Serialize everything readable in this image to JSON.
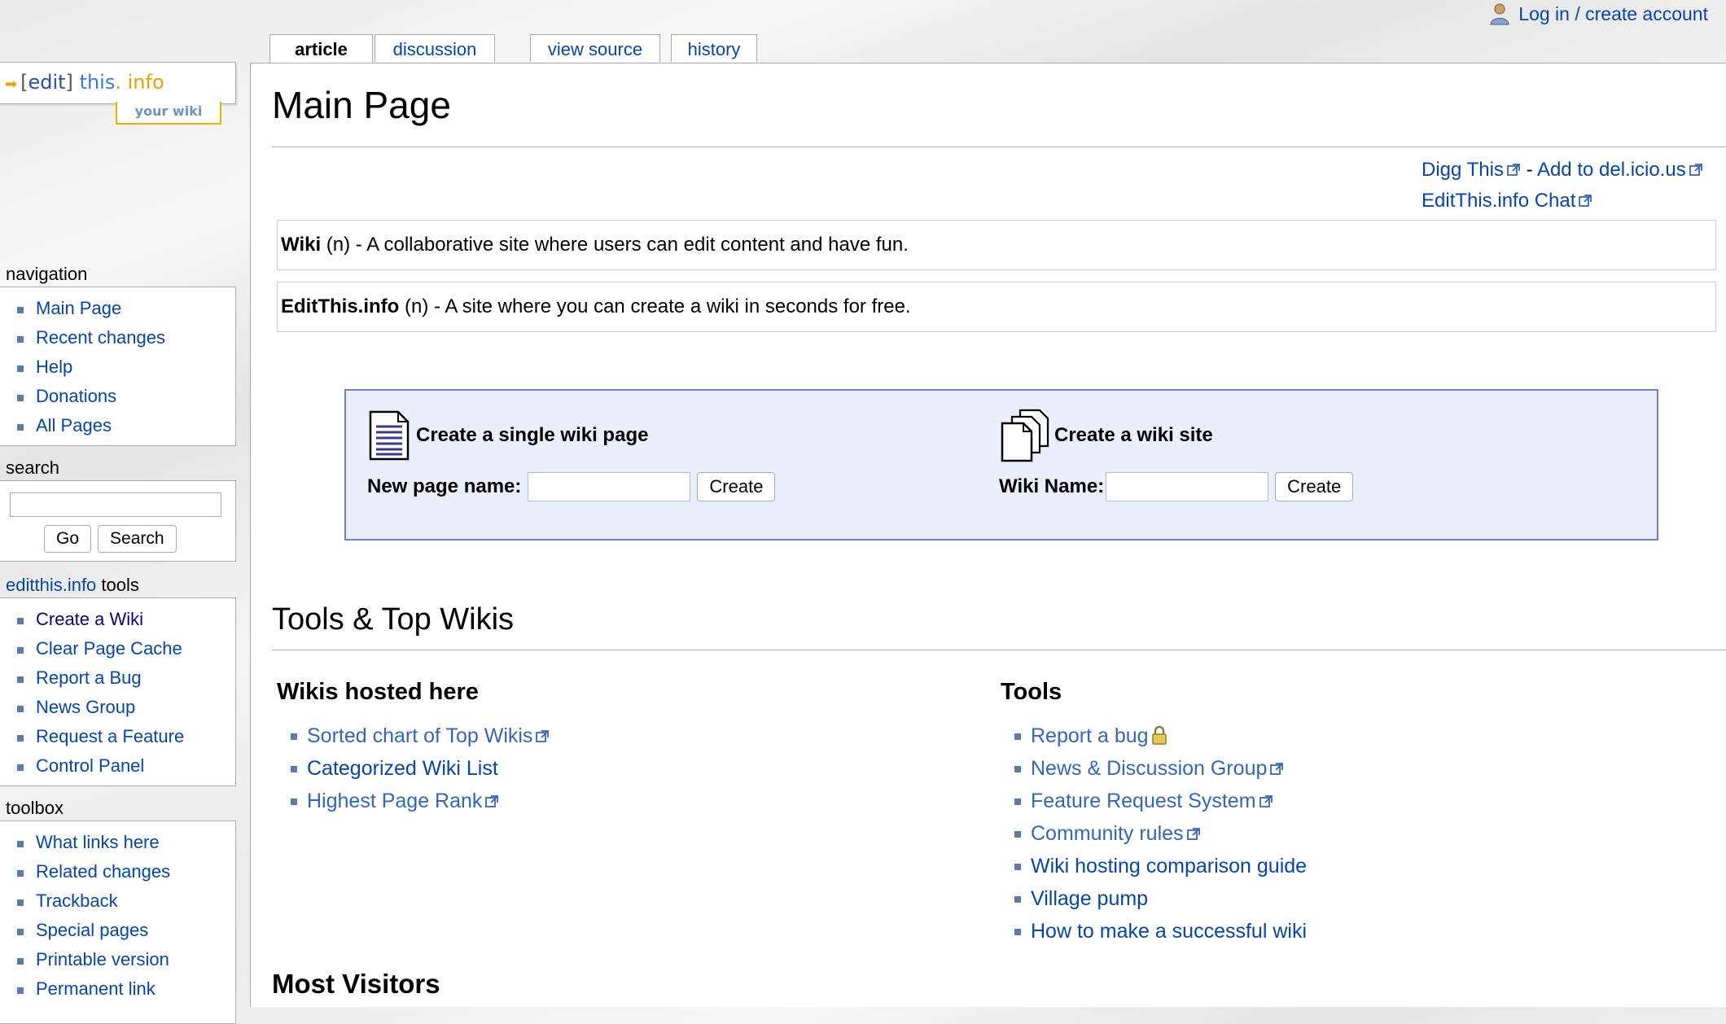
{
  "user_bar": {
    "login_label": "Log in / create account"
  },
  "tabs": [
    {
      "label": "article",
      "selected": true
    },
    {
      "label": "discussion"
    },
    {
      "label": "view source"
    },
    {
      "label": "history"
    }
  ],
  "logo": {
    "edit": "edit",
    "this": "this",
    "dot": ".",
    "info": "info",
    "tagline": "your wiki"
  },
  "sidebar": {
    "navigation": {
      "title": "navigation",
      "items": [
        "Main Page",
        "Recent changes",
        "Help",
        "Donations",
        "All Pages"
      ]
    },
    "search": {
      "title": "search",
      "input_value": "",
      "go_label": "Go",
      "search_label": "Search"
    },
    "tools": {
      "title_prefix": "editthis.info",
      "title_suffix": " tools",
      "items": [
        "Create a Wiki",
        "Clear Page Cache",
        "Report a Bug",
        "News Group",
        "Request a Feature",
        "Control Panel"
      ]
    },
    "toolbox": {
      "title": "toolbox",
      "items": [
        "What links here",
        "Related changes",
        "Trackback",
        "Special pages",
        "Printable version",
        "Permanent link"
      ]
    }
  },
  "content": {
    "heading": "Main Page",
    "top_links": {
      "digg": "Digg This",
      "sep": " - ",
      "delicious": "Add to del.icio.us",
      "chat": "EditThis.info Chat"
    },
    "definitions": [
      {
        "term": "Wiki",
        "rest": " (n) - A collaborative site where users can edit content and have fun."
      },
      {
        "term": "EditThis.info",
        "rest": " (n) - A site where you can create a wiki in seconds for free."
      }
    ],
    "create_box": {
      "single": {
        "title": "Create a single wiki page",
        "label": "New page name:",
        "input_value": "",
        "button": "Create"
      },
      "site": {
        "title": "Create a wiki site",
        "label": "Wiki Name:",
        "input_value": "",
        "button": "Create"
      }
    },
    "section_heading": "Tools & Top Wikis",
    "wikis": {
      "heading": "Wikis hosted here",
      "items": [
        "Sorted chart of Top Wikis",
        "Categorized Wiki List",
        "Highest Page Rank"
      ]
    },
    "tools": {
      "heading": "Tools",
      "items": [
        "Report a bug",
        "News & Discussion Group",
        "Feature Request System",
        "Community rules",
        "Wiki hosting comparison guide",
        "Village pump",
        "How to make a successful wiki"
      ]
    },
    "most_visitors": "Most Visitors"
  },
  "colors": {
    "link": "#0645ad",
    "create_box_bg": "#eaeefd",
    "create_box_border": "#6d7fd9",
    "bullet": "#5c7aaa"
  }
}
